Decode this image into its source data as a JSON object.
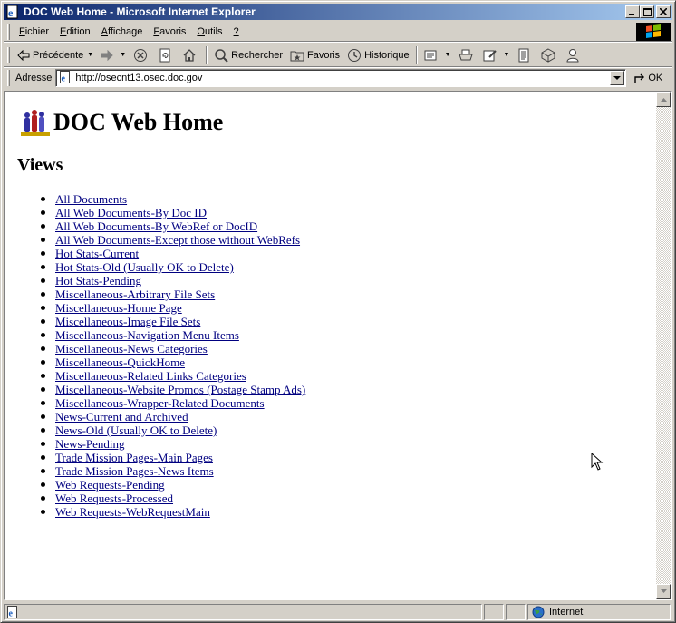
{
  "window": {
    "title": "DOC Web Home - Microsoft Internet Explorer"
  },
  "menu": {
    "items": [
      {
        "label": "Fichier"
      },
      {
        "label": "Edition"
      },
      {
        "label": "Affichage"
      },
      {
        "label": "Favoris"
      },
      {
        "label": "Outils"
      },
      {
        "label": "?"
      }
    ]
  },
  "toolbar": {
    "back_label": "Précédente",
    "search_label": "Rechercher",
    "favorites_label": "Favoris",
    "history_label": "Historique"
  },
  "address": {
    "label": "Adresse",
    "url": "http://osecnt13.osec.doc.gov",
    "go_label": "OK"
  },
  "page": {
    "title": "DOC Web Home",
    "section": "Views",
    "links": [
      "All Documents",
      "All Web Documents-By Doc ID",
      "All Web Documents-By WebRef or DocID",
      "All Web Documents-Except those without WebRefs",
      "Hot Stats-Current",
      "Hot Stats-Old (Usually OK to Delete)",
      "Hot Stats-Pending",
      "Miscellaneous-Arbitrary File Sets",
      "Miscellaneous-Home Page",
      "Miscellaneous-Image File Sets",
      "Miscellaneous-Navigation Menu Items",
      "Miscellaneous-News Categories",
      "Miscellaneous-QuickHome",
      "Miscellaneous-Related Links Categories",
      "Miscellaneous-Website Promos (Postage Stamp Ads)",
      "Miscellaneous-Wrapper-Related Documents",
      "News-Current and Archived",
      "News-Old (Usually OK to Delete)",
      "News-Pending",
      "Trade Mission Pages-Main Pages",
      "Trade Mission Pages-News Items",
      "Web Requests-Pending",
      "Web Requests-Processed",
      "Web Requests-WebRequestMain"
    ]
  },
  "status": {
    "zone": "Internet"
  },
  "colors": {
    "titlebar_start": "#0a246a",
    "titlebar_end": "#a6caf0",
    "link": "#000080",
    "chrome": "#d4d0c8"
  }
}
